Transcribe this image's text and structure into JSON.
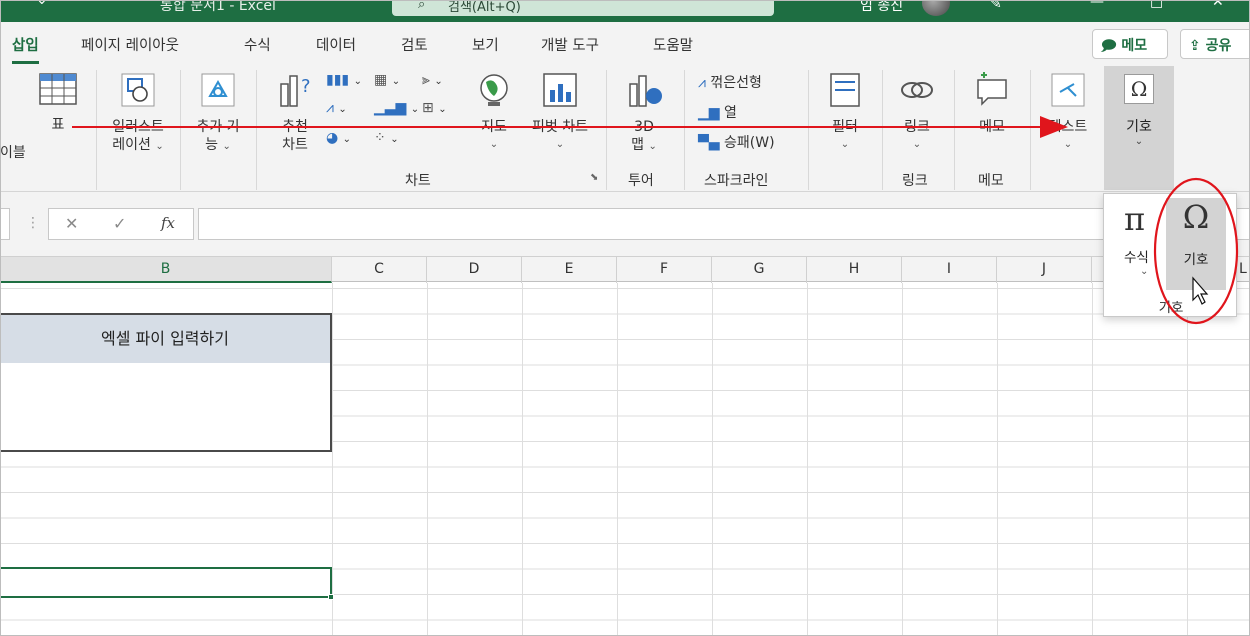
{
  "titlebar": {
    "doc_title": "통합 문서1  -  Excel",
    "search_placeholder": "검색(Alt+Q)",
    "user_name": "임 종진"
  },
  "tabs": {
    "active": "삽입",
    "items": [
      "페이지 레이아웃",
      "수식",
      "데이터",
      "검토",
      "보기",
      "개발 도구",
      "도움말"
    ],
    "memo": "메모",
    "share": "공유"
  },
  "ribbon": {
    "table_partial": "이블",
    "table": "표",
    "illust_1": "일러스트",
    "illust_2": "레이션",
    "addin_1": "추가 기",
    "addin_2": "능",
    "rec_1": "추천",
    "rec_2": "차트",
    "maps": "지도",
    "pivot": "피벗 차트",
    "chart_group": "차트",
    "map3d_1": "3D",
    "map3d_2": "맵",
    "tour_group": "투어",
    "spark_line": "꺾은선형",
    "spark_col": "열",
    "spark_winloss": "승패(W)",
    "spark_group": "스파크라인",
    "filter": "필터",
    "link": "링크",
    "link_group": "링크",
    "comment": "메모",
    "comment_group": "메모",
    "text": "텍스트",
    "symbols": "기호"
  },
  "formula_bar": {
    "cancel": "✕",
    "enter": "✓",
    "fx": "fx",
    "value": ""
  },
  "columns": [
    "B",
    "C",
    "D",
    "E",
    "F",
    "G",
    "H",
    "I",
    "J",
    "K",
    "L"
  ],
  "sheet": {
    "header_cell": "엑셀 파이 입력하기"
  },
  "popup": {
    "equation": "수식",
    "symbol": "기호",
    "group": "기호"
  },
  "colors": {
    "excel_green": "#1e6e42",
    "annotation_red": "#e0151c"
  }
}
